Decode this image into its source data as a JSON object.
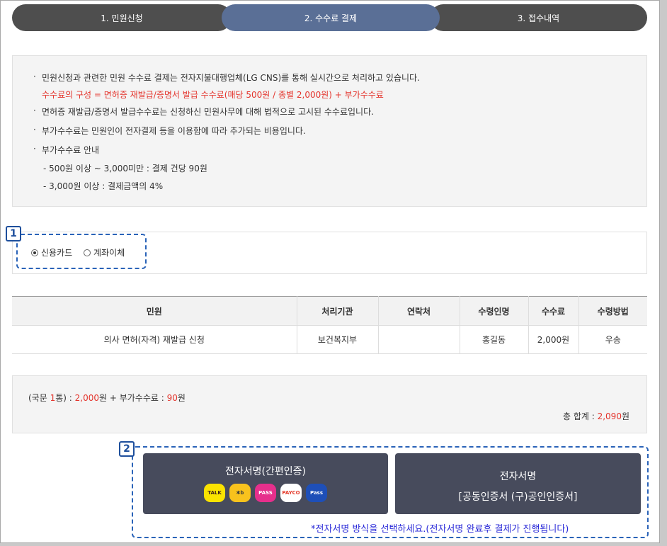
{
  "steps": [
    {
      "label": "1. 민원신청",
      "state": "done"
    },
    {
      "label": "2. 수수료 결제",
      "state": "active"
    },
    {
      "label": "3. 접수내역",
      "state": "pending"
    }
  ],
  "info": {
    "bullet": "·",
    "line1": "민원신청과 관련한 민원 수수료 결제는 전자지불대행업체(LG CNS)를 통해 실시간으로 처리하고 있습니다.",
    "line1_red": "수수료의 구성 = 면허증 재발급/증명서 발급 수수료(매당 500원 / 종별 2,000원) + 부가수수료",
    "line2": "면허증 재발급/증명서 발급수수료는 신청하신 민원사무에 대해 법적으로 고시된 수수료입니다.",
    "line3": "부가수수료는 민원인이 전자결제 등을 이용함에 따라 추가되는 비용입니다.",
    "line4": "부가수수료 안내",
    "sub1": "- 500원 이상 ~ 3,000미만 : 결제 건당 90원",
    "sub2": "- 3,000원 이상 : 결제금액의 4%"
  },
  "callouts": {
    "one": "1",
    "two": "2"
  },
  "payment": {
    "options": [
      {
        "label": "신용카드",
        "checked": true
      },
      {
        "label": "계좌이체",
        "checked": false
      }
    ]
  },
  "table": {
    "headers": [
      "민원",
      "처리기관",
      "연락처",
      "수령인명",
      "수수료",
      "수령방법"
    ],
    "rows": [
      [
        "의사 면허(자격) 재발급 신청",
        "보건복지부",
        "",
        "홍길동",
        "2,000원",
        "우송"
      ]
    ]
  },
  "fee": {
    "prefix": "(국문 ",
    "count": "1",
    "unit_close": "통) : ",
    "amount": "2,000",
    "won1": "원 + 부가수수료 : ",
    "extra": "90",
    "won2": "원",
    "total_label": "총 합계 : ",
    "total": "2,090",
    "total_won": "원"
  },
  "sign": {
    "simple_label": "전자서명(간편인증)",
    "cert_label1": "전자서명",
    "cert_label2": "[공동인증서 (구)공인인증서]",
    "logos": [
      {
        "name": "kakao",
        "text": "TALK",
        "bg": "#fbe300",
        "fg": "#3c1e1e"
      },
      {
        "name": "kb",
        "text": "✱b",
        "bg": "#f8c21d",
        "fg": "#3b3b3b"
      },
      {
        "name": "pass",
        "text": "PASS",
        "bg": "#e62f8c",
        "fg": "#ffffff"
      },
      {
        "name": "payco",
        "text": "PAYCO",
        "bg": "#ffffff",
        "fg": "#e43b2c"
      },
      {
        "name": "samsung-pass",
        "text": "Pass",
        "bg": "#1e4fb8",
        "fg": "#ffffff"
      }
    ],
    "note": "*전자서명 방식을 선택하세요.(전자서명 완료후 결제가 진행됩니다)"
  },
  "colors": {
    "accent": "#5a6f96",
    "step": "#4e4e4e",
    "red": "#e4342c",
    "button": "#474b5c",
    "callout": "#1e4f9c"
  }
}
